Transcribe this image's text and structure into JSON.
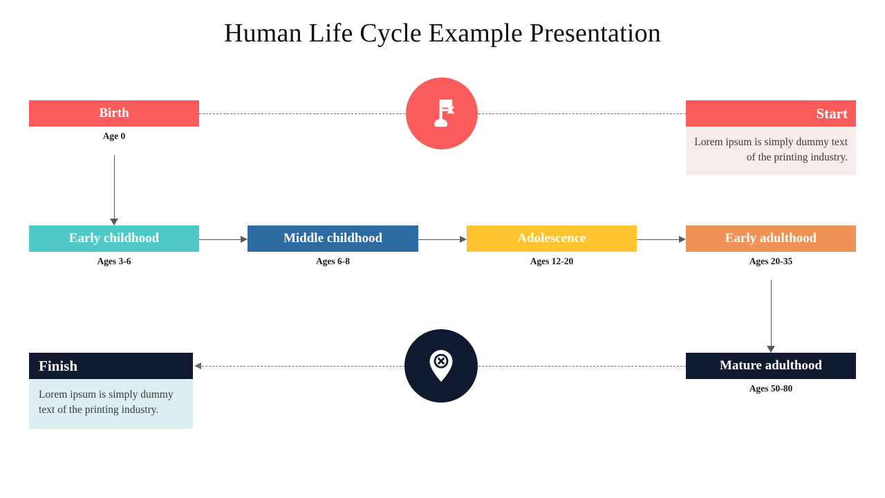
{
  "slide": {
    "title": "Human Life Cycle Example Presentation",
    "background": "#ffffff"
  },
  "start_card": {
    "title": "Start",
    "body": "Lorem ipsum is simply dummy text of the printing industry.",
    "bar_color": "#fb5b5b",
    "body_color": "#f7ece9"
  },
  "finish_card": {
    "title": "Finish",
    "body": "Lorem ipsum is simply dummy text of the printing industry.",
    "bar_color": "#101a2e",
    "body_color": "#ddeef3"
  },
  "icons": {
    "flag": {
      "name": "flag-icon",
      "circle_color": "#fb5b5b",
      "glyph_color": "#ffffff"
    },
    "pin": {
      "name": "map-pin-icon",
      "circle_color": "#101a2e",
      "glyph_color": "#ffffff"
    }
  },
  "stages": [
    {
      "label": "Birth",
      "caption": "Age 0",
      "color": "#fb5b5b"
    },
    {
      "label": "Early childhood",
      "caption": "Ages 3-6",
      "color": "#4ec8c8"
    },
    {
      "label": "Middle childhood",
      "caption": "Ages 6-8",
      "color": "#2d6ba3"
    },
    {
      "label": "Adolescence",
      "caption": "Ages 12-20",
      "color": "#fdc430"
    },
    {
      "label": "Early adulthood",
      "caption": "Ages 20-35",
      "color": "#ef9258"
    },
    {
      "label": "Mature adulthood",
      "caption": "Ages 50-80",
      "color": "#101a2e"
    }
  ]
}
